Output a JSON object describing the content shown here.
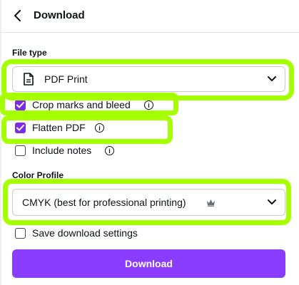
{
  "header": {
    "title": "Download"
  },
  "file_type": {
    "label": "File type",
    "selected": "PDF Print",
    "options": [
      {
        "label": "Crop marks and bleed",
        "checked": true,
        "info": true
      },
      {
        "label": "Flatten PDF",
        "checked": true,
        "info": true
      },
      {
        "label": "Include notes",
        "checked": false,
        "info": true
      }
    ]
  },
  "color_profile": {
    "label": "Color Profile",
    "selected": "CMYK (best for professional printing)"
  },
  "save_settings": {
    "label": "Save download settings",
    "checked": false
  },
  "download_button": {
    "label": "Download"
  },
  "colors": {
    "accent": "#8b3dff",
    "checkbox": "#7d2ae8",
    "highlight": "#a6ff00"
  },
  "icons": [
    "back-arrow-icon",
    "document-icon",
    "chevron-down-icon",
    "info-icon",
    "crown-icon",
    "checkmark-icon"
  ]
}
